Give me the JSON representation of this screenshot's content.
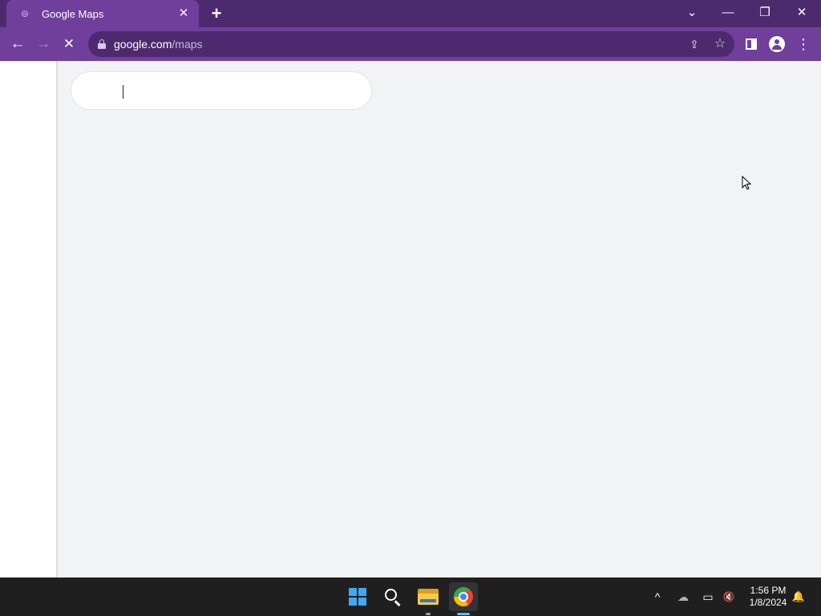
{
  "browser": {
    "tab": {
      "title": "Google Maps",
      "favicon": "google-maps-favicon"
    },
    "new_tab_label": "+",
    "window_controls": {
      "tab_search": "⌄",
      "minimize": "—",
      "restore": "❐",
      "close": "✕"
    },
    "toolbar": {
      "back": "←",
      "forward": "→",
      "stop": "✕",
      "url_host": "google.com",
      "url_path": "/maps",
      "share": "⇪",
      "bookmark": "☆",
      "menu": "⋮"
    },
    "accent_color": "#6f3f9b",
    "frame_color": "#4d2a6e"
  },
  "maps": {
    "search": {
      "value": "",
      "placeholder": ""
    },
    "loading": true
  },
  "taskbar": {
    "apps": [
      "start-button",
      "search",
      "file-explorer",
      "google-chrome"
    ],
    "tray": {
      "overflow": "^",
      "onedrive": "☁",
      "network": "▭",
      "volume": "🔇",
      "notifications": "🔔"
    },
    "clock": {
      "time": "1:56 PM",
      "date": "1/8/2024"
    }
  }
}
